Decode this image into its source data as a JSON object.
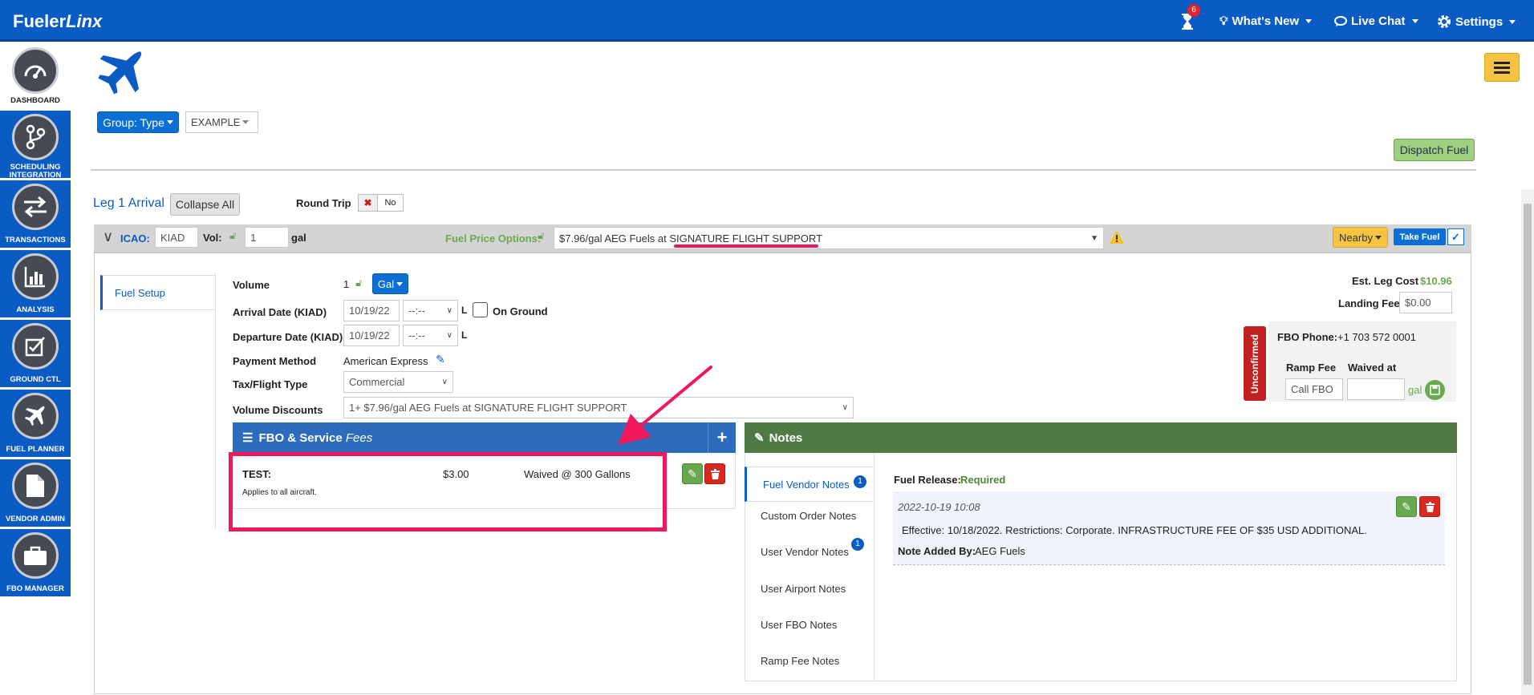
{
  "app": {
    "brand_part1": "Fueler",
    "brand_part2": "Linx"
  },
  "topbar": {
    "notification_count": "6",
    "whats_new": "What's New",
    "live_chat": "Live Chat",
    "settings": "Settings"
  },
  "sidebar": {
    "items": [
      {
        "label": "DASHBOARD",
        "icon": "gauge-icon"
      },
      {
        "label": "SCHEDULING INTEGRATION",
        "icon": "branch-icon"
      },
      {
        "label": "TRANSACTIONS",
        "icon": "swap-arrows-icon"
      },
      {
        "label": "ANALYSIS",
        "icon": "bar-chart-icon"
      },
      {
        "label": "GROUND CTL",
        "icon": "checklist-icon"
      },
      {
        "label": "FUEL PLANNER",
        "icon": "airplane-icon"
      },
      {
        "label": "VENDOR ADMIN",
        "icon": "document-icon"
      },
      {
        "label": "FBO MANAGER",
        "icon": "briefcase-icon"
      }
    ]
  },
  "header": {
    "group_button": "Group: Type",
    "example_select": "EXAMPLE",
    "dispatch_button": "Dispatch Fuel"
  },
  "leg": {
    "title": "Leg 1 Arrival",
    "collapse_all": "Collapse All",
    "round_trip_label": "Round Trip",
    "round_trip_value": "No",
    "icao_label": "ICAO:",
    "icao_value": "KIAD",
    "vol_label": "Vol:",
    "vol_value": "1",
    "vol_unit": "gal",
    "fuel_price_label": "Fuel Price Options:",
    "fuel_price_prefix": "$7.96/gal AEG Fuels at ",
    "fuel_price_fbo": "SIGNATURE FLIGHT SUPPORT",
    "nearby": "Nearby",
    "take_fuel": "Take Fuel"
  },
  "fuel_setup": {
    "tab": "Fuel Setup",
    "volume_label": "Volume",
    "volume_value": "1",
    "volume_unit": "Gal",
    "arrival_label": "Arrival Date (KIAD)",
    "arrival_date": "10/19/22",
    "arrival_time": "--:--",
    "time_suffix": "L",
    "on_ground": "On Ground",
    "departure_label": "Departure Date (KIAD)",
    "departure_date": "10/19/22",
    "departure_time": "--:--",
    "payment_label": "Payment Method",
    "payment_value": "American Express",
    "tax_label": "Tax/Flight Type",
    "tax_value": "Commercial",
    "discount_label": "Volume Discounts",
    "discount_value": "1+ $7.96/gal AEG Fuels at SIGNATURE FLIGHT SUPPORT"
  },
  "right_panel": {
    "est_leg_cost_label": "Est. Leg Cost",
    "est_leg_cost_value": "$10.96",
    "landing_fee_label": "Landing Fee",
    "landing_fee_value": "$0.00",
    "unconfirmed": "Unconfirmed",
    "fbo_phone_label": "FBO Phone:",
    "fbo_phone_value": "+1 703 572 0001",
    "ramp_fee_label": "Ramp Fee",
    "waived_at_label": "Waived at",
    "ramp_fee_value": "Call FBO",
    "waived_unit": "gal"
  },
  "fbo_fees": {
    "title_main": "FBO & Service ",
    "title_italic": "Fees",
    "fee_name": "TEST:",
    "fee_amount": "$3.00",
    "fee_waived": "Waived @ 300 Gallons",
    "fee_note": "Applies to all aircraft."
  },
  "notes": {
    "title": "Notes",
    "tabs": [
      {
        "label": "Fuel Vendor Notes",
        "badge": "1"
      },
      {
        "label": "Custom Order Notes",
        "badge": ""
      },
      {
        "label": "User Vendor Notes",
        "badge": "1"
      },
      {
        "label": "User Airport Notes",
        "badge": ""
      },
      {
        "label": "User FBO Notes",
        "badge": ""
      },
      {
        "label": "Ramp Fee Notes",
        "badge": ""
      }
    ],
    "fuel_release_label": "Fuel Release:",
    "fuel_release_value": "Required",
    "note_date": "2022-10-19 10:08",
    "note_text": "Effective: 10/18/2022. Restrictions: Corporate. INFRASTRUCTURE FEE OF $35 USD ADDITIONAL.",
    "added_by_label": "Note Added By:",
    "added_by_value": "AEG Fuels"
  },
  "colors": {
    "brand_blue": "#0b5bc4",
    "notes_green": "#4f7a45",
    "annotation_pink": "#f0185a"
  }
}
